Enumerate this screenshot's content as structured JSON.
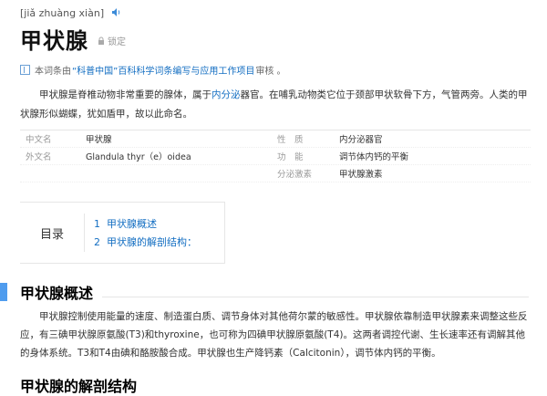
{
  "header": {
    "pinyin": "[jiǎ zhuàng xiàn]",
    "title": "甲状腺",
    "lock_label": "锁定"
  },
  "notice": {
    "prefix": "本词条由",
    "link": "“科普中国”百科科学词条编写与应用工作项目",
    "suffix": "审核 。"
  },
  "intro": {
    "before_link": "甲状腺是脊椎动物非常重要的腺体，属于",
    "link": "内分泌",
    "after_link": "器官。在哺乳动物类它位于颈部甲状软骨下方，气管两旁。人类的甲状腺形似蝴蝶，犹如盾甲，故以此命名。"
  },
  "basic_info": {
    "rows": [
      {
        "l1": "中文名",
        "v1": "甲状腺",
        "l2": "性　质",
        "v2": "内分泌器官"
      },
      {
        "l1": "外文名",
        "v1": "Glandula thyr（e）oidea",
        "l2": "功　能",
        "v2": "调节体内钙的平衡"
      },
      {
        "l1": "",
        "v1": "",
        "l2": "分泌激素",
        "v2": "甲状腺激素"
      }
    ]
  },
  "toc": {
    "heading": "目录",
    "items": [
      {
        "num": "1",
        "label": "甲状腺概述"
      },
      {
        "num": "2",
        "label": "甲状腺的解剖结构："
      }
    ]
  },
  "section1": {
    "title": "甲状腺概述",
    "body": "甲状腺控制使用能量的速度、制造蛋白质、调节身体对其他荷尔蒙的敏感性。甲状腺依靠制造甲状腺素来调整这些反应，有三碘甲状腺原氨酸(T3)和thyroxine，也可称为四碘甲状腺原氨酸(T4)。这两者调控代谢、生长速率还有调解其他的身体系统。T3和T4由碘和酪胺酸合成。甲状腺也生产降钙素（Calcitonin），调节体内钙的平衡。"
  },
  "section2": {
    "title": "甲状腺的解剖结构"
  },
  "colors": {
    "link": "#136ec2",
    "accent_bar": "#4f9cee"
  },
  "icons": {
    "audio": "speaker-icon",
    "lock": "lock-icon",
    "notice": "book-icon"
  }
}
